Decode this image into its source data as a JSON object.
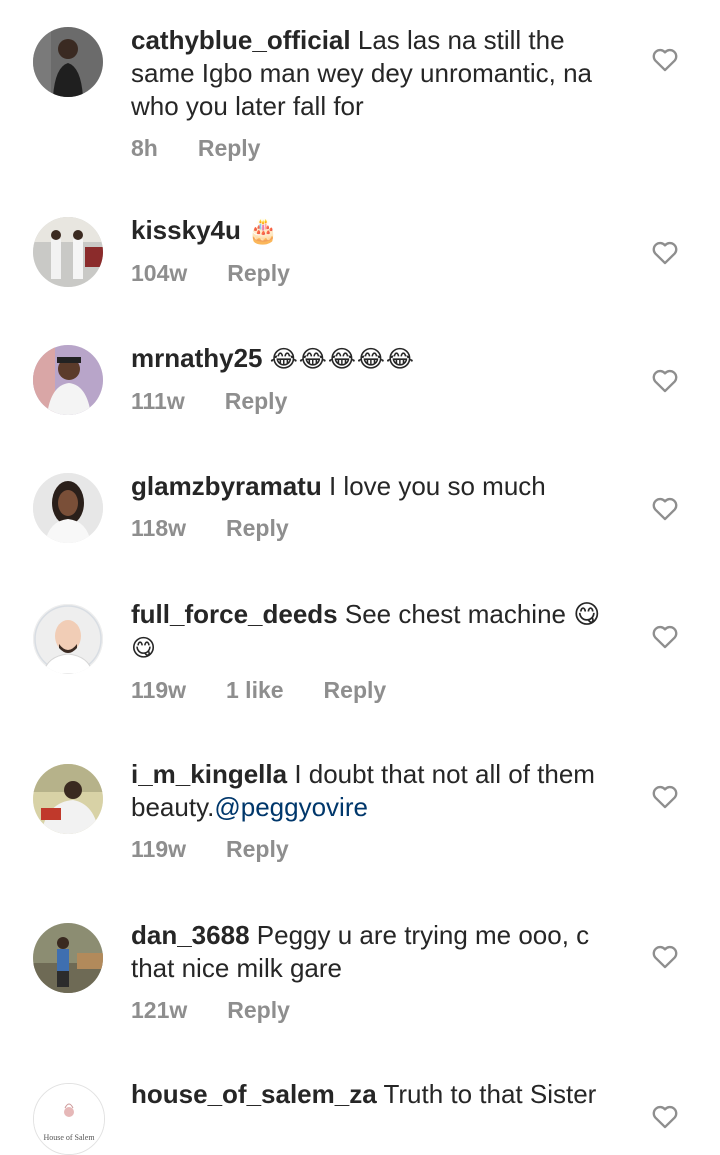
{
  "comments": [
    {
      "user": "cathyblue_official",
      "text_lines": [
        "Las las na still the",
        "same Igbo man wey dey unromantic, na",
        "who you later fall for"
      ],
      "time": "8h",
      "likes": "",
      "reply": "Reply"
    },
    {
      "user": "kissky4u",
      "text": "🎂",
      "time": "104w",
      "likes": "",
      "reply": "Reply"
    },
    {
      "user": "mrnathy25",
      "text": "😂😂😂😂😂",
      "time": "111w",
      "likes": "",
      "reply": "Reply"
    },
    {
      "user": "glamzbyramatu",
      "text": "I love you so much",
      "time": "118w",
      "likes": "",
      "reply": "Reply"
    },
    {
      "user": "full_force_deeds",
      "text_lines": [
        "See chest machine 😋",
        "😋"
      ],
      "time": "119w",
      "likes": "1 like",
      "reply": "Reply"
    },
    {
      "user": "i_m_kingella",
      "text_lines": [
        "I doubt that not all of them",
        "beauty."
      ],
      "mention": "@peggyovire",
      "time": "119w",
      "likes": "",
      "reply": "Reply"
    },
    {
      "user": "dan_3688",
      "text_lines": [
        "Peggy u are trying me ooo, c",
        "that nice milk gare"
      ],
      "time": "121w",
      "likes": "",
      "reply": "Reply"
    },
    {
      "user": "house_of_salem_za",
      "text": "Truth to that Sister",
      "avatar_text": "House of Salem",
      "time": "",
      "likes": "",
      "reply": ""
    }
  ],
  "colors": {
    "username": "#262626",
    "meta": "#8e8e8e",
    "mention": "#00376b",
    "heart": "#8e8e8e"
  },
  "icons": {
    "heart": "heart-outline-icon"
  }
}
